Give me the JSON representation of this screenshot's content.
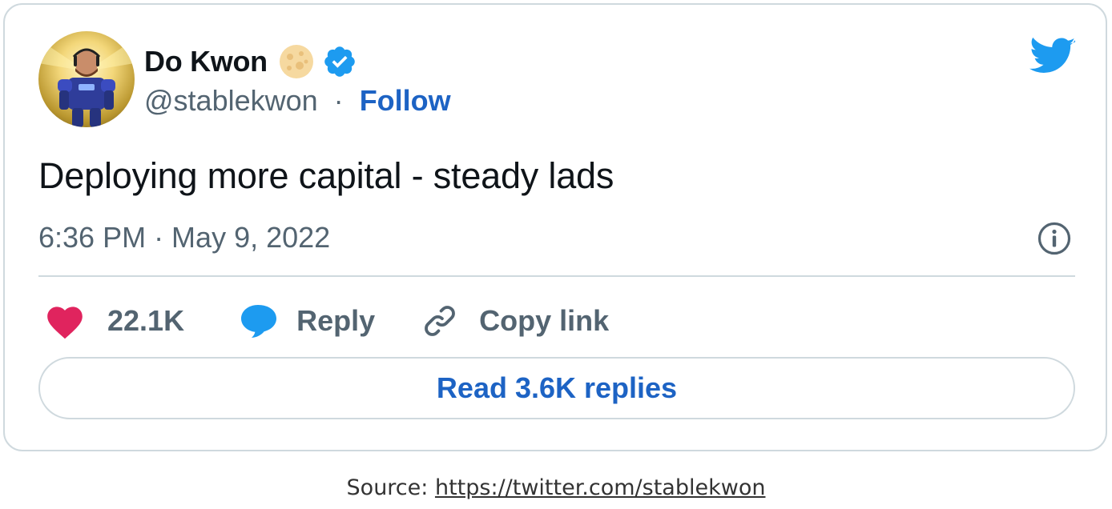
{
  "tweet": {
    "author_name": "Do Kwon",
    "handle": "@stablekwon",
    "separator": "·",
    "follow_label": "Follow",
    "text": "Deploying more capital - steady lads",
    "timestamp": "6:36 PM · May 9, 2022",
    "likes_count": "22.1K",
    "reply_label": "Reply",
    "copy_link_label": "Copy link",
    "read_replies_label": "Read 3.6K replies"
  },
  "icons": {
    "brand": "twitter-bird-icon",
    "verified": "verified-badge-icon",
    "emoji": "moon-emoji-icon",
    "info": "info-icon",
    "like": "heart-icon",
    "reply": "speech-bubble-icon",
    "copy": "link-icon"
  },
  "colors": {
    "link_blue": "#1d63c4",
    "twitter_blue": "#1d9bf0",
    "heart_pink": "#e0245e",
    "muted_text": "#536471",
    "border": "#cfd9de"
  },
  "caption": {
    "prefix": "Source: ",
    "url": "https://twitter.com/stablekwon"
  }
}
